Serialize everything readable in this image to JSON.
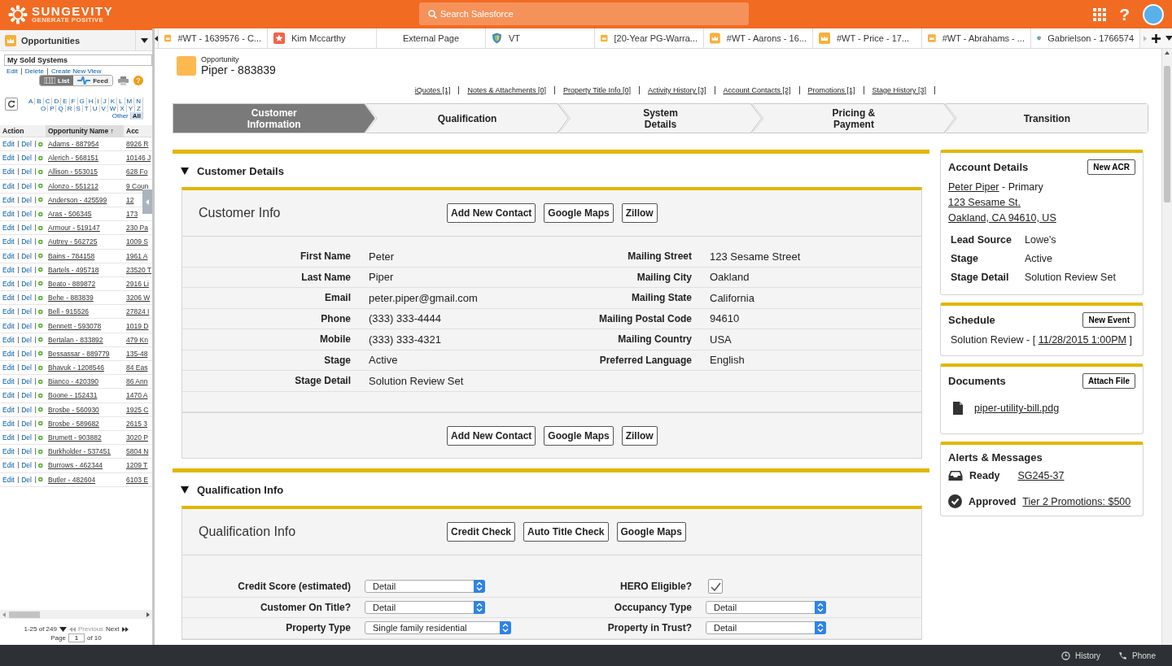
{
  "top_bar": {
    "logo_name": "SUNGEVITY",
    "logo_tagline": "GENERATE POSITIVE",
    "search_placeholder": "Search Salesforce",
    "help": "?"
  },
  "sidebar": {
    "title": "Opportunities",
    "view": "My Sold Systems",
    "view_links": [
      "Edit",
      "Delete",
      "Create New View"
    ],
    "toggle": [
      {
        "label": "List",
        "kind": "list",
        "selected": true
      },
      {
        "label": "Feed",
        "kind": "feed",
        "selected": false
      }
    ],
    "help": "?",
    "letters": [
      {
        "label": "A",
        "selected": false
      },
      {
        "label": "B",
        "selected": false
      },
      {
        "label": "C",
        "selected": false
      },
      {
        "label": "D",
        "selected": false
      },
      {
        "label": "E",
        "selected": false
      },
      {
        "label": "F",
        "selected": false
      },
      {
        "label": "G",
        "selected": false
      },
      {
        "label": "H",
        "selected": false
      },
      {
        "label": "I",
        "selected": false
      },
      {
        "label": "J",
        "selected": false
      },
      {
        "label": "K",
        "selected": false
      },
      {
        "label": "L",
        "selected": false
      },
      {
        "label": "M",
        "selected": false
      },
      {
        "label": "N",
        "selected": false
      },
      {
        "label": "O",
        "selected": false
      },
      {
        "label": "P",
        "selected": false
      },
      {
        "label": "Q",
        "selected": false
      },
      {
        "label": "R",
        "selected": false
      },
      {
        "label": "S",
        "selected": false
      },
      {
        "label": "T",
        "selected": false
      },
      {
        "label": "U",
        "selected": false
      },
      {
        "label": "V",
        "selected": false
      },
      {
        "label": "W",
        "selected": false
      },
      {
        "label": "X",
        "selected": false
      },
      {
        "label": "Y",
        "selected": false
      },
      {
        "label": "Z",
        "selected": false
      },
      {
        "label": "Other",
        "selected": false
      },
      {
        "label": "All",
        "selected": true
      }
    ],
    "columns": [
      "Action",
      "Opportunity Name",
      "Acc"
    ],
    "sort_mark": "↑",
    "rows": [
      {
        "actions": [
          "Edit",
          "Del"
        ],
        "name": "Adams - 887954",
        "account": "8926 R"
      },
      {
        "actions": [
          "Edit",
          "Del"
        ],
        "name": "Alerich - 568151",
        "account": "10146 J"
      },
      {
        "actions": [
          "Edit",
          "Del"
        ],
        "name": "Allison - 553015",
        "account": "628 Fo"
      },
      {
        "actions": [
          "Edit",
          "Del"
        ],
        "name": "Alonzo - 551212",
        "account": "9 Coun"
      },
      {
        "actions": [
          "Edit",
          "Del"
        ],
        "name": "Anderson - 425599",
        "account": "12"
      },
      {
        "actions": [
          "Edit",
          "Del"
        ],
        "name": "Aras - 506345",
        "account": "173"
      },
      {
        "actions": [
          "Edit",
          "Del"
        ],
        "name": "Armour - 519147",
        "account": "230 Pa"
      },
      {
        "actions": [
          "Edit",
          "Del"
        ],
        "name": "Autrey - 562725",
        "account": "1009 S"
      },
      {
        "actions": [
          "Edit",
          "Del"
        ],
        "name": "Bains - 784158",
        "account": "1961 A"
      },
      {
        "actions": [
          "Edit",
          "Del"
        ],
        "name": "Bartels - 495718",
        "account": "23520 T"
      },
      {
        "actions": [
          "Edit",
          "Del"
        ],
        "name": "Beato - 889872",
        "account": "2916 Li"
      },
      {
        "actions": [
          "Edit",
          "Del"
        ],
        "name": "Behe - 883839",
        "account": "3206 W"
      },
      {
        "actions": [
          "Edit",
          "Del"
        ],
        "name": "Bell - 915526",
        "account": "27824 I"
      },
      {
        "actions": [
          "Edit",
          "Del"
        ],
        "name": "Bennett - 593078",
        "account": "1019 D"
      },
      {
        "actions": [
          "Edit",
          "Del"
        ],
        "name": "Bertalan - 833892",
        "account": "479 Kn"
      },
      {
        "actions": [
          "Edit",
          "Del"
        ],
        "name": "Bessassar - 889779",
        "account": "135-48"
      },
      {
        "actions": [
          "Edit",
          "Del"
        ],
        "name": "Bhavuk - 1208546",
        "account": "84 Eas"
      },
      {
        "actions": [
          "Edit",
          "Del"
        ],
        "name": "Bianco - 420390",
        "account": "86 Ann"
      },
      {
        "actions": [
          "Edit",
          "Del"
        ],
        "name": "Boone - 152431",
        "account": "1470 A"
      },
      {
        "actions": [
          "Edit",
          "Del"
        ],
        "name": "Brosbe - 560930",
        "account": "1925 C"
      },
      {
        "actions": [
          "Edit",
          "Del"
        ],
        "name": "Brosbe - 589682",
        "account": "2615 3"
      },
      {
        "actions": [
          "Edit",
          "Del"
        ],
        "name": "Brumett - 903882",
        "account": "3020 P"
      },
      {
        "actions": [
          "Edit",
          "Del"
        ],
        "name": "Burkholder - 537451",
        "account": "5804 N"
      },
      {
        "actions": [
          "Edit",
          "Del"
        ],
        "name": "Burrows - 462344",
        "account": "1209 T"
      },
      {
        "actions": [
          "Edit",
          "Del"
        ],
        "name": "Butler - 482604",
        "account": "6103 E"
      }
    ],
    "pagination": {
      "range": "1-25 of 249",
      "previous": "Previous",
      "previous_disabled": true,
      "next": "Next",
      "next_disabled": false,
      "page_label": "Page",
      "page": "1",
      "page_total": "of 10"
    }
  },
  "tabs": [
    {
      "label": "#WT - 1639576 - C...",
      "kind": "crown"
    },
    {
      "label": "Kim Mccarthy",
      "kind": "star"
    },
    {
      "label": "External Page",
      "kind": "plain"
    },
    {
      "label": "VT",
      "kind": "shield"
    },
    {
      "label": "[20-Year PG-Warra...",
      "kind": "crown"
    },
    {
      "label": "#WT - Aarons - 16...",
      "kind": "crown"
    },
    {
      "label": "#WT - Price - 17...",
      "kind": "crown"
    },
    {
      "label": "#WT - Abrahams - ...",
      "kind": "crown"
    },
    {
      "label": "Gabrielson - 1766574",
      "kind": "shield"
    }
  ],
  "record": {
    "type": "Opportunity",
    "name": "Piper - 883839"
  },
  "related_links": [
    "iQuotes [1]",
    "Notes & Attachments [0]",
    "Property Title Info [0]",
    "Activity History [3]",
    "Account Contacts [2]",
    "Promotions [1]",
    "Stage History [3]"
  ],
  "path": [
    {
      "label": "Customer Information",
      "selected": true
    },
    {
      "label": "Qualification",
      "selected": false
    },
    {
      "label": "System Details",
      "selected": false
    },
    {
      "label": "Pricing & Payment",
      "selected": false
    },
    {
      "label": "Transition",
      "selected": false
    }
  ],
  "sections": [
    {
      "title": "Customer Details",
      "expanded": true,
      "card_title": "Customer Info",
      "buttons": [
        "Add New Contact",
        "Google Maps",
        "Zillow"
      ],
      "footer_buttons": [
        "Add New Contact",
        "Google Maps",
        "Zillow"
      ],
      "rows": [
        {
          "left": {
            "label": "First Name",
            "kind": "text",
            "value": "Peter"
          },
          "right": {
            "label": "Mailing Street",
            "kind": "text",
            "value": "123 Sesame Street"
          }
        },
        {
          "left": {
            "label": "Last Name",
            "kind": "text",
            "value": "Piper"
          },
          "right": {
            "label": "Mailing City",
            "kind": "text",
            "value": "Oakland"
          }
        },
        {
          "left": {
            "label": "Email",
            "kind": "text",
            "value": "peter.piper@gmail.com"
          },
          "right": {
            "label": "Mailing State",
            "kind": "text",
            "value": "California"
          }
        },
        {
          "left": {
            "label": "Phone",
            "kind": "text",
            "value": "(333) 333-4444"
          },
          "right": {
            "label": "Mailing Postal Code",
            "kind": "text",
            "value": "94610"
          }
        },
        {
          "left": {
            "label": "Mobile",
            "kind": "text",
            "value": "(333) 333-4321"
          },
          "right": {
            "label": "Mailing Country",
            "kind": "text",
            "value": "USA"
          }
        },
        {
          "left": {
            "label": "Stage",
            "kind": "text",
            "value": "Active"
          },
          "right": {
            "label": "Preferred Language",
            "kind": "text",
            "value": "English"
          }
        },
        {
          "left": {
            "label": "Stage Detail",
            "kind": "text",
            "value": "Solution Review Set"
          }
        },
        {}
      ]
    },
    {
      "title": "Qualification Info",
      "expanded": true,
      "card_title": "Qualification Info",
      "buttons": [
        "Credit Check",
        "Auto Title Check",
        "Google Maps"
      ],
      "rows": [
        {
          "left": {
            "label": "Credit Score (estimated)",
            "kind": "select",
            "value": "Detail"
          },
          "right": {
            "label": "HERO Eligible?",
            "kind": "checkbox",
            "checked": true
          }
        },
        {
          "left": {
            "label": "Customer On Title?",
            "kind": "select",
            "value": "Detail"
          },
          "right": {
            "label": "Occupancy Type",
            "kind": "select",
            "value": "Detail"
          }
        },
        {
          "left": {
            "label": "Property Type",
            "kind": "select",
            "value": "Single family residential"
          },
          "right": {
            "label": "Property in Trust?",
            "kind": "select",
            "value": "Detail"
          }
        }
      ]
    }
  ],
  "account": {
    "title": "Account Details",
    "button": "New ACR",
    "contact": "Peter Piper",
    "contact_role": "- Primary",
    "address": [
      "123 Sesame St.",
      "Oakland, CA 94610, US"
    ],
    "fields": [
      {
        "label": "Lead Source",
        "value": "Lowe's"
      },
      {
        "label": "Stage",
        "value": "Active"
      },
      {
        "label": "Stage Detail",
        "value": "Solution Review Set"
      }
    ]
  },
  "schedule": {
    "title": "Schedule",
    "button": "New Event",
    "event": "Solution Review - [",
    "date": "11/28/2015 1:00PM",
    "close": "]"
  },
  "documents": {
    "title": "Documents",
    "button": "Attach File",
    "files": [
      "piper-utility-bill.pdg"
    ]
  },
  "alerts": {
    "title": "Alerts & Messages",
    "items": [
      {
        "kind": "inbox",
        "status": "Ready",
        "link": "SG245-37"
      },
      {
        "kind": "check",
        "status": "Approved",
        "link": "Tier 2 Promotions: $500"
      }
    ]
  },
  "footer": [
    {
      "label": "History",
      "kind": "clock"
    },
    {
      "label": "Phone",
      "kind": "phone"
    }
  ]
}
